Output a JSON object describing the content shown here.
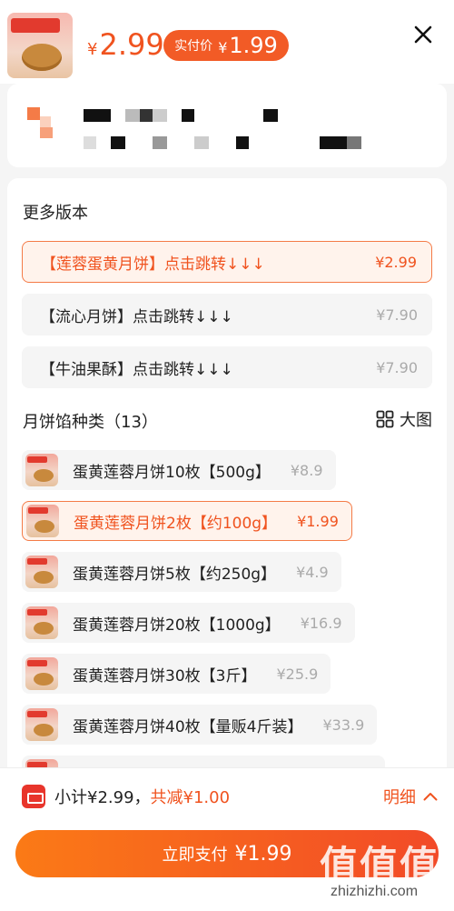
{
  "header": {
    "price_yen": "¥",
    "price_value": "2.99",
    "actual_pay_label": "实付价",
    "actual_pay_yen": "¥",
    "actual_pay_value": "1.99"
  },
  "versions": {
    "title": "更多版本",
    "items": [
      {
        "name": "【莲蓉蛋黄月饼】点击跳转↓↓↓",
        "price": "¥2.99",
        "active": true
      },
      {
        "name": "【流心月饼】点击跳转↓↓↓",
        "price": "¥7.90",
        "active": false
      },
      {
        "name": "【牛油果酥】点击跳转↓↓↓",
        "price": "¥7.90",
        "active": false
      }
    ]
  },
  "flavors": {
    "title": "月饼馅种类（13）",
    "big_view_label": "大图",
    "items": [
      {
        "name": "蛋黄莲蓉月饼10枚【500g】",
        "price": "¥8.9",
        "active": false
      },
      {
        "name": "蛋黄莲蓉月饼2枚【约100g】",
        "price": "¥1.99",
        "active": true
      },
      {
        "name": "蛋黄莲蓉月饼5枚【约250g】",
        "price": "¥4.9",
        "active": false
      },
      {
        "name": "蛋黄莲蓉月饼20枚【1000g】",
        "price": "¥16.9",
        "active": false
      },
      {
        "name": "蛋黄莲蓉月饼30枚【3斤】",
        "price": "¥25.9",
        "active": false
      },
      {
        "name": "蛋黄莲蓉月饼40枚【量贩4斤装】",
        "price": "¥33.9",
        "active": false
      }
    ]
  },
  "footer": {
    "subtotal_text": "小计¥2.99，",
    "reduce_text": "共减¥1.00",
    "detail_label": "明细",
    "pay_label": "立即支付",
    "pay_value": "¥1.99"
  },
  "watermark": {
    "glyphs": "值值值",
    "url": "zhizhizhi.com"
  },
  "colors": {
    "accent": "#f0531f",
    "accent_light_bg": "#fff3ec",
    "pay_gradient_start": "#fb7a16",
    "pay_gradient_end": "#f24a28"
  }
}
